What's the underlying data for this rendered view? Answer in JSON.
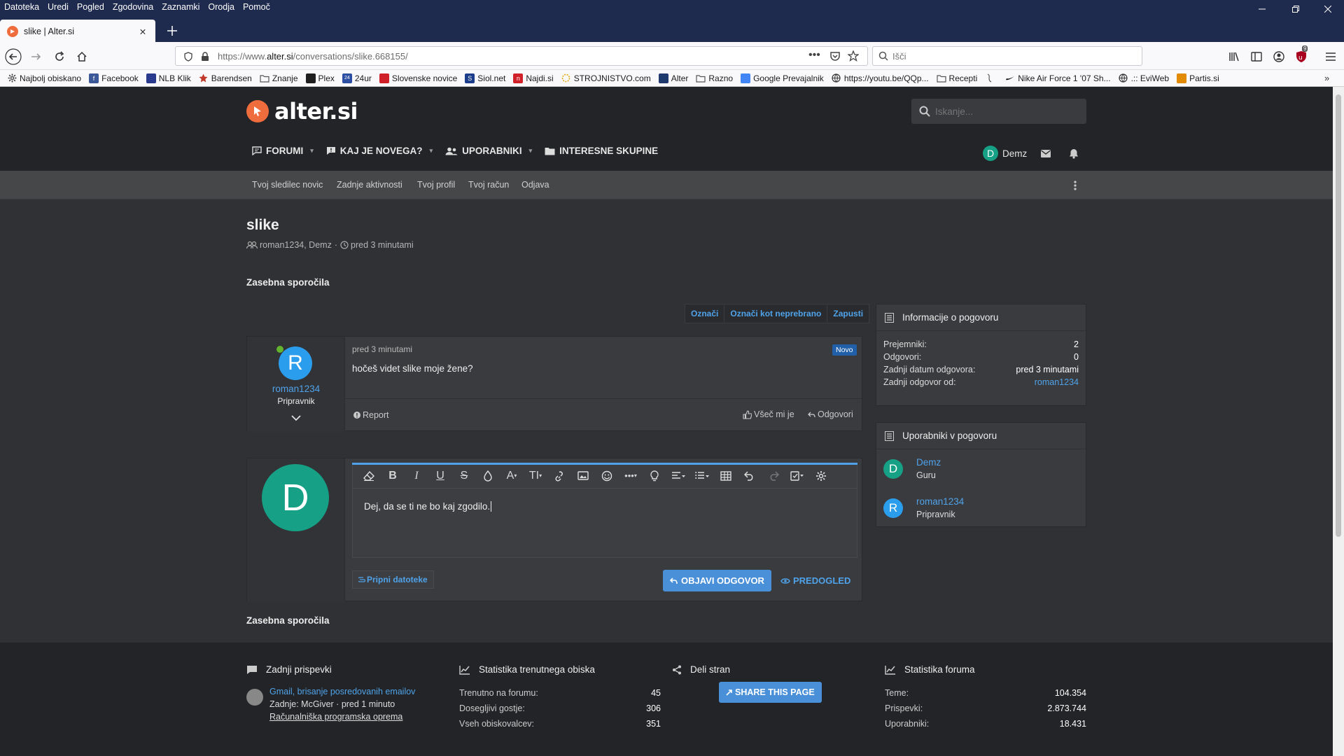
{
  "browser": {
    "menu": [
      "Datoteka",
      "Uredi",
      "Pogled",
      "Zgodovina",
      "Zaznamki",
      "Orodja",
      "Pomoč"
    ],
    "tab_title": "slike | Alter.si",
    "url_prefix": "https://www.",
    "url_domain": "alter.si",
    "url_path": "/conversations/slike.668155/",
    "search_placeholder": "Išči",
    "ext_badge": "9",
    "bookmarks": [
      {
        "label": "Najbolj obiskano",
        "icon": "gear-icon",
        "color": "#555"
      },
      {
        "label": "Facebook",
        "icon": "facebook-icon",
        "color": "#3b5998"
      },
      {
        "label": "NLB Klik",
        "icon": "nlb-icon",
        "color": "#2a3b8f"
      },
      {
        "label": "Barendsen",
        "icon": "star-icon",
        "color": "#c0392b"
      },
      {
        "label": "Znanje",
        "icon": "folder-icon",
        "color": "#777"
      },
      {
        "label": "Plex",
        "icon": "plex-icon",
        "color": "#1f1f1f"
      },
      {
        "label": "24ur",
        "icon": "24ur-icon",
        "color": "#2d4fa3"
      },
      {
        "label": "Slovenske novice",
        "icon": "novice-icon",
        "color": "#d0202a"
      },
      {
        "label": "Siol.net",
        "icon": "siol-icon",
        "color": "#1c3d8c"
      },
      {
        "label": "Najdi.si",
        "icon": "najdi-icon",
        "color": "#d0202a"
      },
      {
        "label": "STROJNISTVO.com",
        "icon": "sun-icon",
        "color": "#e2a400"
      },
      {
        "label": "Alter",
        "icon": "alter-icon",
        "color": "#1f3b6e"
      },
      {
        "label": "Razno",
        "icon": "folder-icon",
        "color": "#777"
      },
      {
        "label": "Google Prevajalnik",
        "icon": "translate-icon",
        "color": "#4285f4"
      },
      {
        "label": "https://youtu.be/QQp...",
        "icon": "globe-icon",
        "color": "#444"
      },
      {
        "label": "Recepti",
        "icon": "folder-icon",
        "color": "#777"
      },
      {
        "label": "",
        "icon": "link-icon",
        "color": "#666"
      },
      {
        "label": "Nike Air Force 1 '07 Sh...",
        "icon": "nike-icon",
        "color": "#111"
      },
      {
        "label": ".:: EviWeb",
        "icon": "globe-icon",
        "color": "#444"
      },
      {
        "label": "Partis.si",
        "icon": "partis-icon",
        "color": "#e28b00"
      }
    ]
  },
  "site": {
    "logo_text": "alter.si",
    "search_placeholder": "Iskanje...",
    "nav": [
      {
        "label": "FORUMI",
        "icon": "forum-icon",
        "dropdown": true
      },
      {
        "label": "KAJ JE NOVEGA?",
        "icon": "whats-new-icon",
        "dropdown": true
      },
      {
        "label": "UPORABNIKI",
        "icon": "users-icon",
        "dropdown": true
      },
      {
        "label": "INTERESNE SKUPINE",
        "icon": "folder-icon",
        "dropdown": false
      }
    ],
    "user": {
      "name": "Demz",
      "initial": "D",
      "color": "#16a085"
    },
    "subnav": [
      "Tvoj sledilec novic",
      "Zadnje aktivnosti",
      "Tvoj profil",
      "Tvoj račun",
      "Odjava"
    ]
  },
  "conversation": {
    "title": "slike",
    "participants": "roman1234, Demz",
    "time": "pred 3 minutami",
    "section": "Zasebna sporočila",
    "actions": [
      "Označi",
      "Označi kot neprebrano",
      "Zapusti"
    ],
    "message": {
      "author": "roman1234",
      "initial": "R",
      "color": "#2b9ded",
      "role": "Pripravnik",
      "time": "pred 3 minutami",
      "badge": "Novo",
      "text": "hočeš videt slike moje žene?",
      "report": "Report",
      "like": "Všeč mi je",
      "reply": "Odgovori"
    },
    "reply_box": {
      "initial": "D",
      "color": "#16a085",
      "draft": "Dej, da se ti ne bo kaj zgodilo.",
      "attach": "Pripni datoteke",
      "post": "OBJAVI ODGOVOR",
      "preview": "PREDOGLED"
    }
  },
  "sidebar": {
    "info_title": "Informacije o pogovoru",
    "info_rows": [
      {
        "label": "Prejemniki:",
        "value": "2",
        "link": false
      },
      {
        "label": "Odgovori:",
        "value": "0",
        "link": false
      },
      {
        "label": "Zadnji datum odgovora:",
        "value": "pred 3 minutami",
        "link": false
      },
      {
        "label": "Zadnji odgovor od:",
        "value": "roman1234",
        "link": true
      }
    ],
    "users_title": "Uporabniki v pogovoru",
    "users": [
      {
        "name": "Demz",
        "role": "Guru",
        "initial": "D",
        "color": "#16a085"
      },
      {
        "name": "roman1234",
        "role": "Pripravnik",
        "initial": "R",
        "color": "#2b9ded"
      }
    ]
  },
  "footer": {
    "latest": {
      "title": "Zadnji prispevki",
      "post_title": "Gmail, brisanje posredovanih emailov",
      "post_meta_prefix": "Zadnje: McGiver · ",
      "post_meta_time": "pred 1 minuto",
      "post_forum": "Računalniška programska oprema"
    },
    "visit": {
      "title": "Statistika trenutnega obiska",
      "rows": [
        {
          "label": "Trenutno na forumu:",
          "value": "45"
        },
        {
          "label": "Dosegljivi gostje:",
          "value": "306"
        },
        {
          "label": "Vseh obiskovalcev:",
          "value": "351"
        }
      ]
    },
    "share": {
      "title": "Deli stran",
      "button": "SHARE THIS PAGE"
    },
    "forum": {
      "title": "Statistika foruma",
      "rows": [
        {
          "label": "Teme:",
          "value": "104.354"
        },
        {
          "label": "Prispevki:",
          "value": "2.873.744"
        },
        {
          "label": "Uporabniki:",
          "value": "18.431"
        }
      ]
    }
  },
  "colors": {
    "accent": "#4fa3ea",
    "brand": "#ef6c3c",
    "button": "#4a90d9",
    "dark": "#232427",
    "page": "#303135"
  }
}
